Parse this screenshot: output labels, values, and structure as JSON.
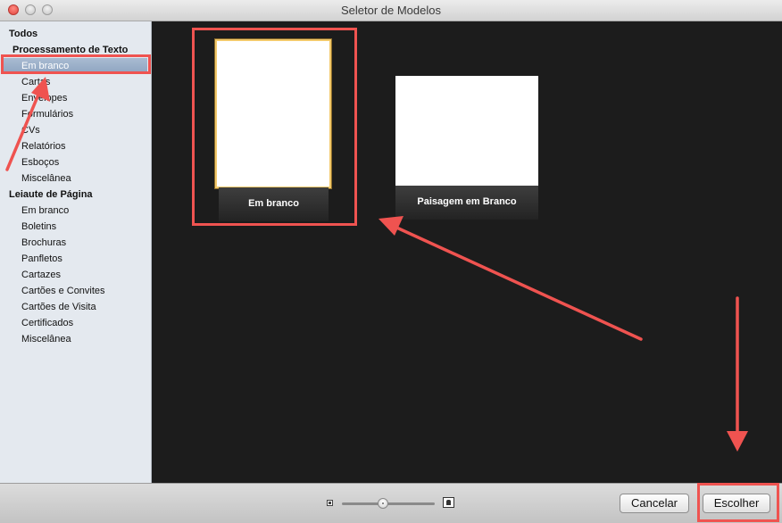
{
  "window": {
    "title": "Seletor de Modelos"
  },
  "sidebar": {
    "all": "Todos",
    "groups": [
      {
        "title": "Processamento de Texto",
        "items": [
          "Em branco",
          "Cartas",
          "Envelopes",
          "Formulários",
          "CVs",
          "Relatórios",
          "Esboços",
          "Miscelânea"
        ]
      },
      {
        "title": "Leiaute de Página",
        "items": [
          "Em branco",
          "Boletins",
          "Brochuras",
          "Panfletos",
          "Cartazes",
          "Cartões e Convites",
          "Cartões de Visita",
          "Certificados",
          "Miscelânea"
        ]
      }
    ],
    "selected": "Em branco"
  },
  "templates": [
    {
      "label": "Em branco",
      "orientation": "portrait",
      "selected": true
    },
    {
      "label": "Paisagem em Branco",
      "orientation": "landscape",
      "selected": false
    }
  ],
  "footer": {
    "cancel_label": "Cancelar",
    "choose_label": "Escolher",
    "zoom_level": 0.5
  },
  "colors": {
    "annotation": "#ef5350",
    "selection_border": "#f3c96b",
    "sidebar_selection": "#9bb0cb"
  }
}
